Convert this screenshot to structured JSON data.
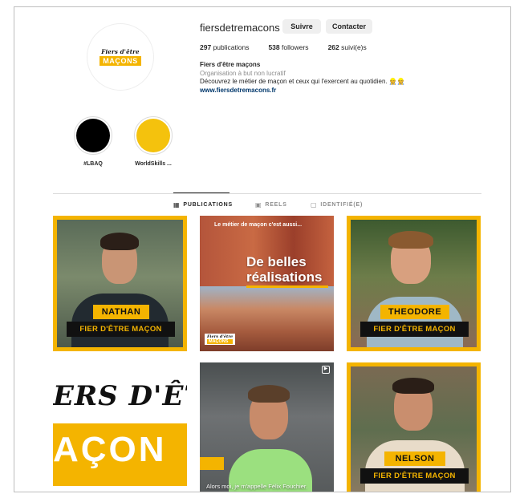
{
  "profile": {
    "username": "fiersdetremacons",
    "follow_label": "Suivre",
    "contact_label": "Contacter",
    "logo_top": "Fiers d'être",
    "logo_bottom": "MAÇONS",
    "stats": {
      "posts_count": "297",
      "posts_label": "publications",
      "followers_count": "538",
      "followers_label": "followers",
      "following_count": "262",
      "following_label": "suivi(e)s"
    },
    "bio": {
      "name": "Fiers d'être maçons",
      "category": "Organisation à but non lucratif",
      "description": "Découvrez le métier de maçon et ceux qui l'exercent au quotidien. 👷👷",
      "link": "www.fiersdetremacons.fr"
    }
  },
  "highlights": [
    {
      "label": "#LBAQ",
      "color": "#000000"
    },
    {
      "label": "WorldSkills ...",
      "color": "#f4c20d"
    }
  ],
  "tabs": [
    {
      "label": "PUBLICATIONS",
      "icon": "grid-icon",
      "active": true
    },
    {
      "label": "REELS",
      "icon": "reels-icon",
      "active": false
    },
    {
      "label": "IDENTIFIÉ(E)",
      "icon": "tagged-icon",
      "active": false
    }
  ],
  "posts": [
    {
      "name": "NATHAN",
      "tagline": "FIER D'ÊTRE MAÇON"
    },
    {
      "subtitle": "Le métier de maçon c'est aussi...",
      "title_line1": "De belles",
      "title_line2": "réalisations",
      "logo_top": "Fiers d'être",
      "logo_bottom": "MAÇONS"
    },
    {
      "name": "THEODORE",
      "tagline": "FIER D'ÊTRE MAÇON"
    },
    {
      "text_line1": "ERS D'ÊT",
      "text_line2": "AÇON"
    },
    {
      "caption": "Alors moi, je m'appelle Félix Fouchier."
    },
    {
      "name": "NELSON",
      "tagline": "FIER D'ÊTRE MAÇON"
    }
  ],
  "colors": {
    "brand_yellow": "#f4b400",
    "link_blue": "#00376b"
  }
}
